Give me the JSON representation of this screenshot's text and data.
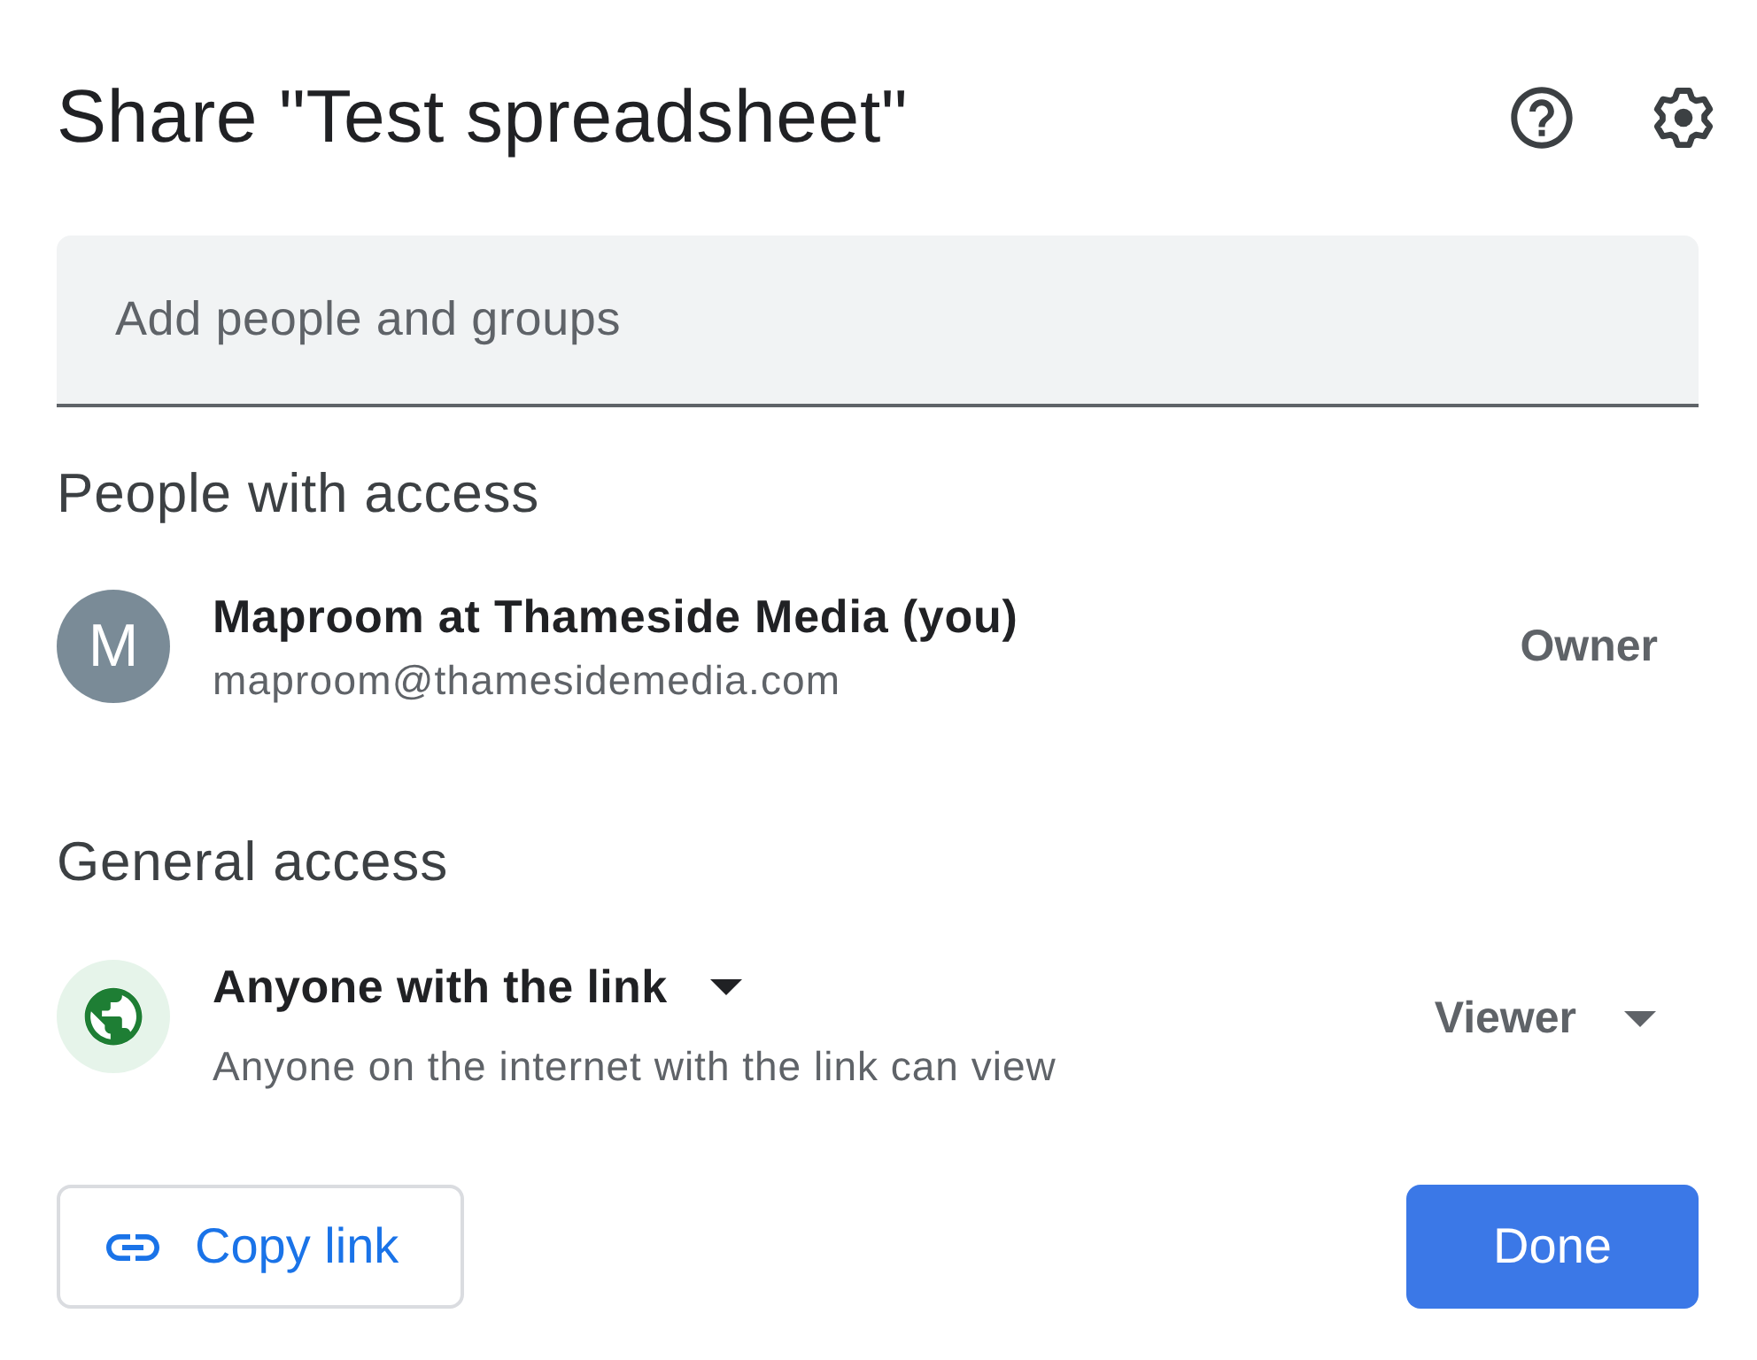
{
  "dialog": {
    "title": "Share \"Test spreadsheet\""
  },
  "search": {
    "placeholder": "Add people and groups"
  },
  "people_with_access": {
    "heading": "People with access",
    "people": [
      {
        "initial": "M",
        "name": "Maproom at Thameside Media (you)",
        "email": "maproom@thamesidemedia.com",
        "role": "Owner"
      }
    ]
  },
  "general_access": {
    "heading": "General access",
    "access": {
      "label": "Anyone with the link",
      "description": "Anyone on the internet with the link can view",
      "role": "Viewer"
    }
  },
  "buttons": [
    {
      "label": "Copy link",
      "kind": "outlined"
    },
    {
      "label": "Done",
      "kind": "filled"
    }
  ]
}
